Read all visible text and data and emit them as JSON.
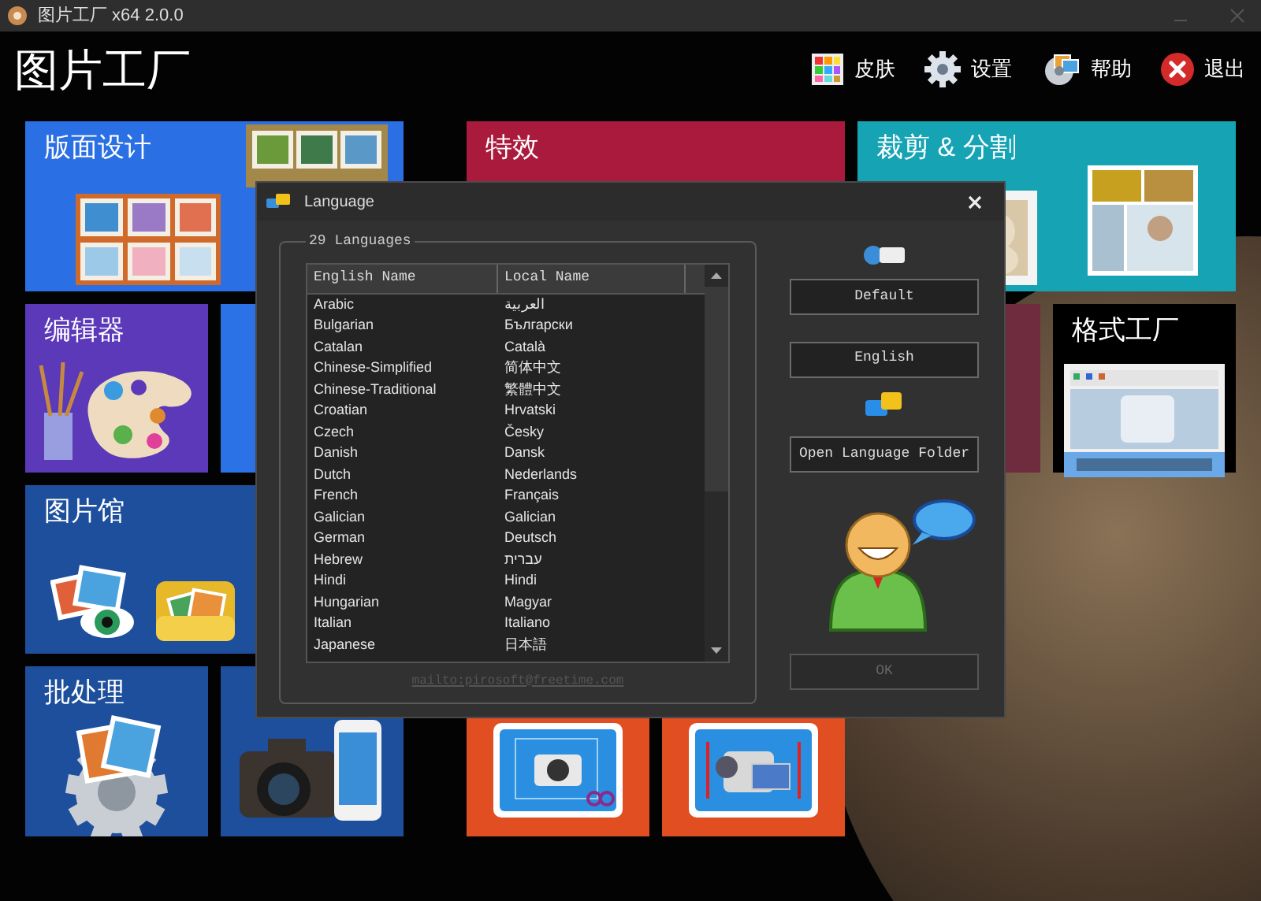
{
  "window": {
    "title": "图片工厂 x64 2.0.0"
  },
  "header": {
    "app_name": "图片工厂",
    "toolbar": [
      {
        "kind": "skin",
        "label": "皮肤"
      },
      {
        "kind": "settings",
        "label": "设置"
      },
      {
        "kind": "help",
        "label": "帮助"
      },
      {
        "kind": "exit",
        "label": "退出"
      }
    ]
  },
  "tile_groups": [
    {
      "tiles": [
        {
          "kind": "layout",
          "title": "版面设计",
          "color": "#2a6fe3",
          "wide": true
        },
        {
          "kind": "editor",
          "title": "编辑器",
          "color": "#5b39b8"
        },
        {
          "kind": "plain",
          "color": "#2b72e6"
        },
        {
          "kind": "gallery",
          "title": "图片馆",
          "color": "#1d4f9c",
          "wide": true
        },
        {
          "kind": "batch",
          "title": "批处理",
          "color": "#1d4f9c"
        },
        {
          "kind": "camera",
          "color": "#1d4f9c"
        }
      ]
    },
    {
      "tiles": [
        {
          "kind": "effects",
          "title": "特效",
          "color": "#a91a3c",
          "wide": true
        },
        {
          "kind": "hidden"
        },
        {
          "kind": "hidden"
        },
        {
          "kind": "hidden"
        },
        {
          "kind": "hidden"
        },
        {
          "kind": "screen-crop",
          "color": "#e04e22"
        },
        {
          "kind": "screen-record",
          "color": "#e04e22"
        }
      ]
    },
    {
      "tiles": [
        {
          "kind": "crop",
          "title": "裁剪 & 分割",
          "color": "#16a4b4",
          "wide": true
        },
        {
          "kind": "plain",
          "color": "#6e2c3e"
        },
        {
          "kind": "format",
          "title": "格式工厂",
          "color": "#000000"
        }
      ]
    }
  ],
  "dialog": {
    "title": "Language",
    "group_label": "29 Languages",
    "columns": [
      "English Name",
      "Local Name"
    ],
    "rows": [
      {
        "english": "Arabic",
        "local": "العربية"
      },
      {
        "english": "Bulgarian",
        "local": "Български"
      },
      {
        "english": "Catalan",
        "local": "Català"
      },
      {
        "english": "Chinese-Simplified",
        "local": "简体中文"
      },
      {
        "english": "Chinese-Traditional",
        "local": "繁體中文"
      },
      {
        "english": "Croatian",
        "local": "Hrvatski"
      },
      {
        "english": "Czech",
        "local": "Česky"
      },
      {
        "english": "Danish",
        "local": "Dansk"
      },
      {
        "english": "Dutch",
        "local": "Nederlands"
      },
      {
        "english": "French",
        "local": "Français"
      },
      {
        "english": "Galician",
        "local": "Galician"
      },
      {
        "english": "German",
        "local": "Deutsch"
      },
      {
        "english": "Hebrew",
        "local": "עברית"
      },
      {
        "english": "Hindi",
        "local": "Hindi"
      },
      {
        "english": "Hungarian",
        "local": "Magyar"
      },
      {
        "english": "Italian",
        "local": "Italiano"
      },
      {
        "english": "Japanese",
        "local": "日本語"
      }
    ],
    "email": "mailto:pirosoft@freetime.com",
    "buttons": [
      {
        "label": "Default",
        "disabled": false
      },
      {
        "label": "English",
        "disabled": false
      },
      {
        "label": "Open Language Folder",
        "disabled": false
      },
      {
        "label": "OK",
        "disabled": true
      }
    ]
  }
}
